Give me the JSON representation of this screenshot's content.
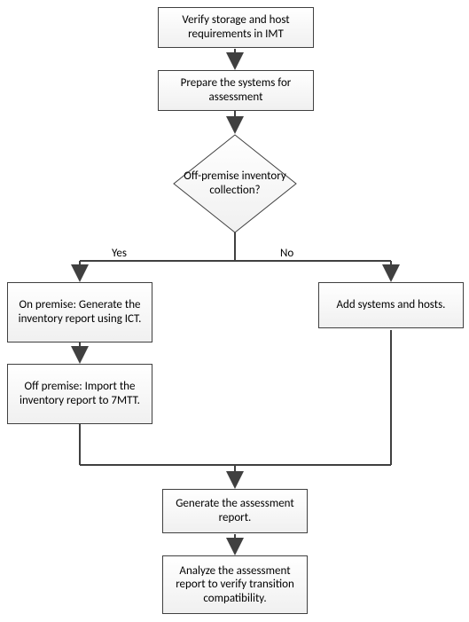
{
  "flow": {
    "nodes": {
      "verify": "Verify storage and host requirements in IMT",
      "prepare": "Prepare the systems for assessment",
      "decision": "Off-premise inventory collection?",
      "onprem": "On premise: Generate the inventory report using ICT.",
      "offprem": "Off premise: Import the inventory report to 7MTT.",
      "add": "Add systems and hosts.",
      "generate": "Generate the assessment report.",
      "analyze": "Analyze the assessment report to verify transition compatibility."
    },
    "edges": {
      "yes": "Yes",
      "no": "No"
    }
  },
  "chart_data": {
    "type": "flowchart",
    "nodes": [
      {
        "id": "verify",
        "kind": "process",
        "label": "Verify storage and host requirements in IMT"
      },
      {
        "id": "prepare",
        "kind": "process",
        "label": "Prepare the systems for assessment"
      },
      {
        "id": "decision",
        "kind": "decision",
        "label": "Off-premise inventory collection?"
      },
      {
        "id": "onprem",
        "kind": "process",
        "label": "On premise: Generate the inventory report using ICT."
      },
      {
        "id": "offprem",
        "kind": "process",
        "label": "Off premise: Import the inventory report to 7MTT."
      },
      {
        "id": "add",
        "kind": "process",
        "label": "Add systems and hosts."
      },
      {
        "id": "generate",
        "kind": "process",
        "label": "Generate the assessment report."
      },
      {
        "id": "analyze",
        "kind": "process",
        "label": "Analyze the assessment report to verify transition compatibility."
      }
    ],
    "edges": [
      {
        "from": "verify",
        "to": "prepare"
      },
      {
        "from": "prepare",
        "to": "decision"
      },
      {
        "from": "decision",
        "to": "onprem",
        "label": "Yes"
      },
      {
        "from": "decision",
        "to": "add",
        "label": "No"
      },
      {
        "from": "onprem",
        "to": "offprem"
      },
      {
        "from": "offprem",
        "to": "generate"
      },
      {
        "from": "add",
        "to": "generate"
      },
      {
        "from": "generate",
        "to": "analyze"
      }
    ]
  }
}
